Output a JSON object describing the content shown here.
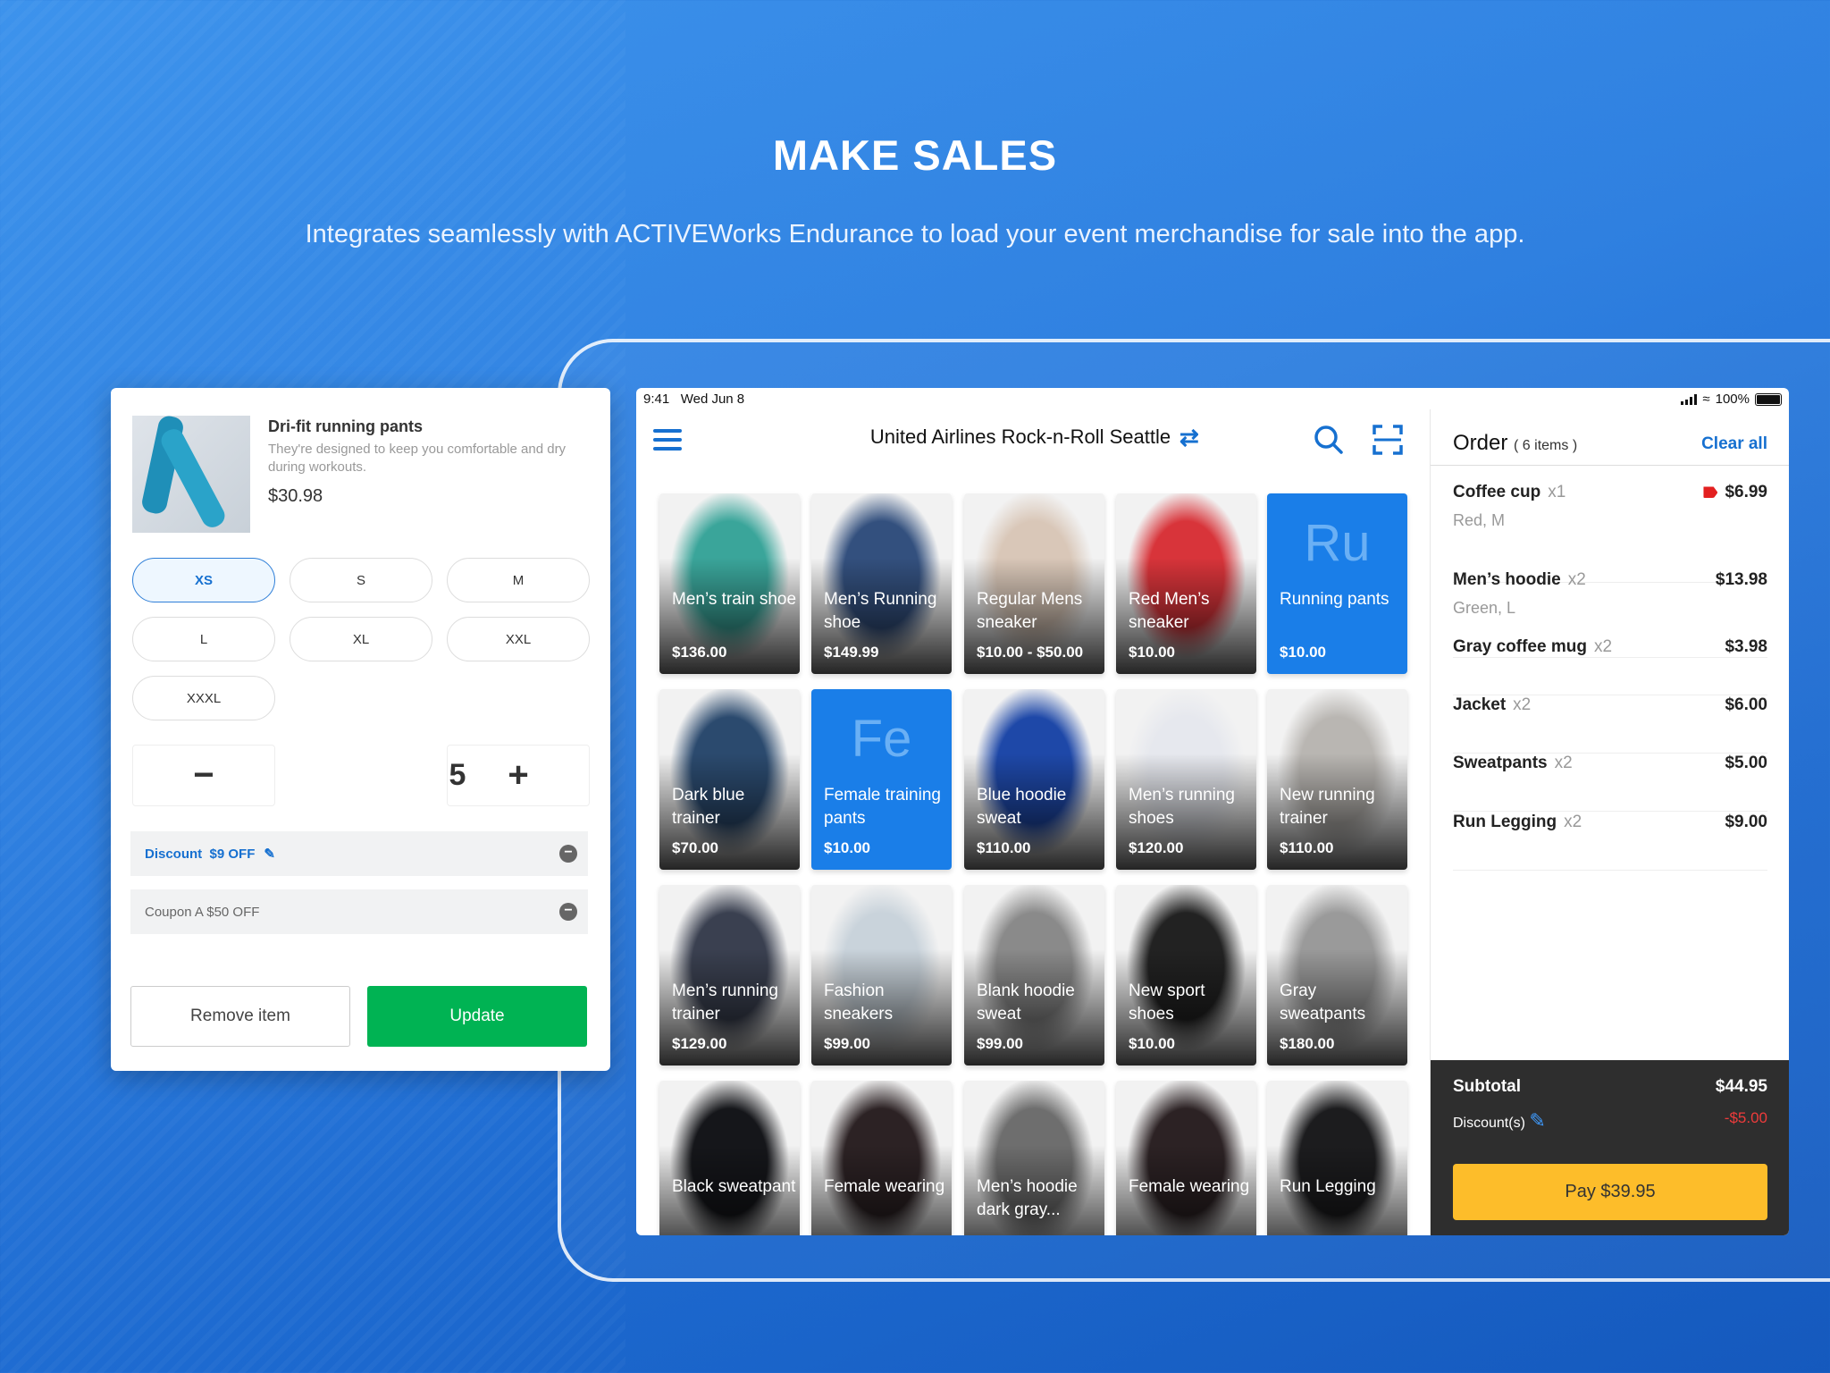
{
  "hero": {
    "title": "MAKE SALES",
    "subtitle": "Integrates seamlessly with ACTIVEWorks Endurance to load your event merchandise for sale into the app."
  },
  "item_editor": {
    "title": "Dri-fit running pants",
    "description": "They're designed to keep you comfortable and dry during workouts.",
    "price": "$30.98",
    "sizes": [
      "XS",
      "S",
      "M",
      "L",
      "XL",
      "XXL",
      "XXXL"
    ],
    "selected_size": "XS",
    "quantity": "5",
    "minus_label": "−",
    "plus_label": "+",
    "discount": {
      "label": "Discount",
      "value": "$9 OFF"
    },
    "coupon": "Coupon A $50 OFF",
    "remove_label": "Remove item",
    "update_label": "Update",
    "colors": {
      "accent": "#1670d0",
      "update": "#00b353"
    }
  },
  "status_bar": {
    "time": "9:41",
    "date": "Wed Jun 8",
    "battery": "100%"
  },
  "header": {
    "event_title": "United Airlines Rock-n-Roll Seattle",
    "swap_icon": "⇄",
    "icons": [
      "menu-icon",
      "search-icon",
      "scan-icon"
    ]
  },
  "products": [
    {
      "name": "Men’s train shoe",
      "price": "$136.00",
      "tint": "#3aa59a"
    },
    {
      "name": "Men’s Running shoe",
      "price": "$149.99",
      "tint": "#33507e"
    },
    {
      "name": "Regular Mens sneaker",
      "price": "$10.00 - $50.00",
      "tint": "#d9c7b8"
    },
    {
      "name": "Red Men’s sneaker",
      "price": "$10.00",
      "tint": "#d8343a"
    },
    {
      "name": "Running pants",
      "price": "$10.00",
      "initials": "Ru"
    },
    {
      "name": "Dark blue trainer",
      "price": "$70.00",
      "tint": "#2b4a6e"
    },
    {
      "name": "Female training pants",
      "price": "$10.00",
      "initials": "Fe"
    },
    {
      "name": "Blue hoodie sweat",
      "price": "$110.00",
      "tint": "#1e48a8"
    },
    {
      "name": "Men’s running shoes",
      "price": "$120.00",
      "tint": "#e6e8ee"
    },
    {
      "name": "New running trainer",
      "price": "$110.00",
      "tint": "#b9b6b2"
    },
    {
      "name": "Men’s running trainer",
      "price": "$129.00",
      "tint": "#3a4050"
    },
    {
      "name": "Fashion sneakers",
      "price": "$99.00",
      "tint": "#c9d3db"
    },
    {
      "name": "Blank hoodie sweat",
      "price": "$99.00",
      "tint": "#8a8a8a"
    },
    {
      "name": "New sport shoes",
      "price": "$10.00",
      "tint": "#222222"
    },
    {
      "name": "Gray sweatpants",
      "price": "$180.00",
      "tint": "#9a9a9a"
    },
    {
      "name": "Black sweatpant",
      "price": "",
      "tint": "#15161a"
    },
    {
      "name": "Female wearing",
      "price": "",
      "tint": "#2c2224"
    },
    {
      "name": "Men’s hoodie dark gray...",
      "price": "",
      "tint": "#6e6e6e"
    },
    {
      "name": "Female wearing",
      "price": "",
      "tint": "#2c2224"
    },
    {
      "name": "Run Legging",
      "price": "",
      "tint": "#1c1c1e"
    }
  ],
  "order": {
    "title": "Order",
    "count": "( 6 items )",
    "clear_label": "Clear all",
    "items": [
      {
        "name": "Coffee cup",
        "qty": "x1",
        "variant": "Red, M",
        "price": "$6.99",
        "discount_tag": true
      },
      {
        "name": "Men’s hoodie",
        "qty": "x2",
        "variant": "Green, L",
        "price": "$13.98"
      },
      {
        "name": "Gray coffee mug",
        "qty": "x2",
        "price": "$3.98"
      },
      {
        "name": "Jacket",
        "qty": "x2",
        "price": "$6.00"
      },
      {
        "name": "Sweatpants",
        "qty": "x2",
        "price": "$5.00"
      },
      {
        "name": "Run Legging",
        "qty": "x2",
        "price": "$9.00"
      }
    ],
    "subtotal_label": "Subtotal",
    "subtotal": "$44.95",
    "discount_label": "Discount(s)",
    "discount": "-$5.00",
    "pay_label": "Pay $39.95",
    "colors": {
      "pay": "#fdbd2a",
      "discount": "#ee3b3b"
    }
  }
}
